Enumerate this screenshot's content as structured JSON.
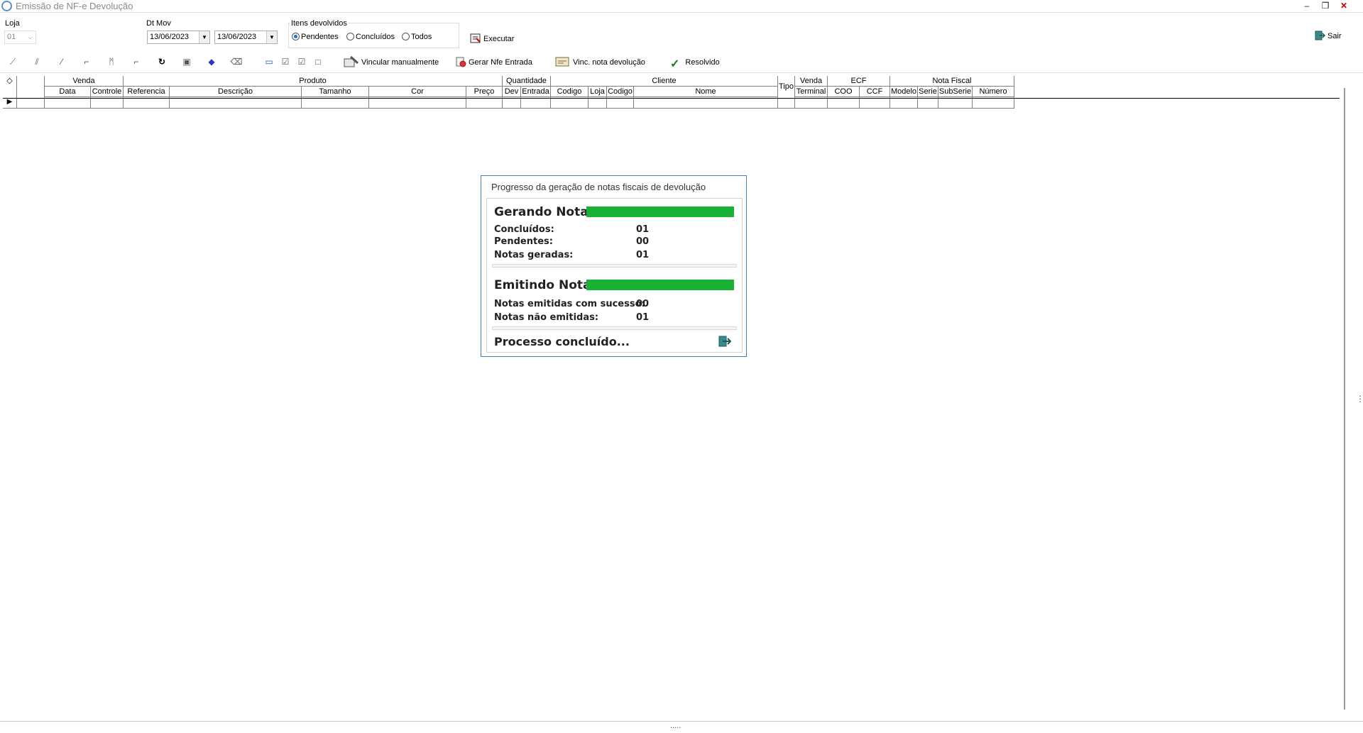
{
  "window": {
    "title": "Emissão de NF-e Devolução",
    "minimize": "–",
    "restore": "❐",
    "close": "✕",
    "close_color": "#cc0000"
  },
  "filters": {
    "loja_label": "Loja",
    "loja_value": "01",
    "dtmov_label": "Dt Mov",
    "date_from": "13/06/2023",
    "date_to": "13/06/2023",
    "itens_label": "Itens devolvidos",
    "radios": [
      {
        "label": "Pendentes",
        "checked": true
      },
      {
        "label": "Concluídos",
        "checked": false
      },
      {
        "label": "Todos",
        "checked": false
      }
    ],
    "executar": "Executar",
    "sair": "Sair"
  },
  "toolbar": {
    "vincular": "Vincular manualmente",
    "gerar": "Gerar Nfe Entrada",
    "vinc_nota": "Vinc. nota devolução",
    "resolvido": "Resolvido"
  },
  "grid": {
    "groups": {
      "venda": "Venda",
      "produto": "Produto",
      "quantidade": "Quantidade",
      "cliente": "Cliente",
      "tipo": "Tipo",
      "venda2": "Venda",
      "ecf": "ECF",
      "nota_fiscal": "Nota Fiscal"
    },
    "columns": {
      "data": "Data",
      "controle": "Controle",
      "referencia": "Referencia",
      "descricao": "Descrição",
      "tamanho": "Tamanho",
      "cor": "Cor",
      "preco": "Preço",
      "dev": "Dev",
      "entrada": "Entrada",
      "codigo": "Codigo",
      "loja": "Loja",
      "codigo2": "Codigo",
      "nome": "Nome",
      "terminal": "Terminal",
      "coo": "COO",
      "ccf": "CCF",
      "modelo": "Modelo",
      "serie": "Serie",
      "subserie": "SubSerie",
      "numero": "Número"
    }
  },
  "progress": {
    "title": "Progresso da geração de notas fiscais de devolução",
    "gerando_title": "Gerando Notas",
    "gerando_progress": 1.0,
    "concluidos_label": "Concluídos:",
    "concluidos_value": "01",
    "pendentes_label": "Pendentes:",
    "pendentes_value": "00",
    "geradas_label": "Notas geradas:",
    "geradas_value": "01",
    "emitindo_title": "Emitindo Notas",
    "emitindo_progress": 1.0,
    "sucesso_label": "Notas emitidas com sucesso:",
    "sucesso_value": "00",
    "nao_label": "Notas não emitidas:",
    "nao_value": "01",
    "status": "Processo concluído...",
    "bar_color": "#19b235"
  },
  "statusbar": {
    "grip": "....."
  }
}
